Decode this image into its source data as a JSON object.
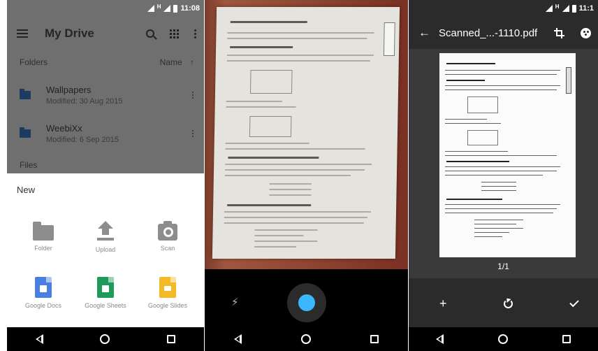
{
  "colors": {
    "drive_folder": "#1d3a63",
    "docs": "#4a7ee0",
    "sheets": "#1f9a58",
    "slides": "#f3b928",
    "shutter_accent": "#3bb7ff",
    "scanner_bg": "#2b2b2b"
  },
  "status": {
    "time_left": "11:08",
    "time_right": "11:1",
    "network": "H"
  },
  "drive": {
    "title": "My Drive",
    "icons": [
      "menu-icon",
      "search-icon",
      "grid-view-icon",
      "more-vert-icon"
    ],
    "folders_label": "Folders",
    "sort_label": "Name",
    "sort_arrow": "↑",
    "folders": [
      {
        "name": "Wallpapers",
        "modified": "Modified: 30 Aug 2015"
      },
      {
        "name": "WeebiXx",
        "modified": "Modified: 6 Sep 2015"
      }
    ],
    "files_label": "Files",
    "new_sheet": {
      "title": "New",
      "actions": [
        {
          "label": "Folder",
          "icon": "folder-icon"
        },
        {
          "label": "Upload",
          "icon": "upload-icon"
        },
        {
          "label": "Scan",
          "icon": "camera-icon"
        },
        {
          "label": "Google Docs",
          "icon": "docs-icon"
        },
        {
          "label": "Google Sheets",
          "icon": "sheets-icon"
        },
        {
          "label": "Google Slides",
          "icon": "slides-icon"
        }
      ]
    }
  },
  "camera": {
    "flash_icon": "flash-off-icon",
    "shutter_icon": "shutter-icon"
  },
  "scanner": {
    "title": "Scanned_...-1110.pdf",
    "back_icon": "←",
    "page_count": "1/1",
    "add_icon": "+"
  },
  "nav": {
    "icons": [
      "back-icon",
      "home-icon",
      "recents-icon"
    ]
  }
}
